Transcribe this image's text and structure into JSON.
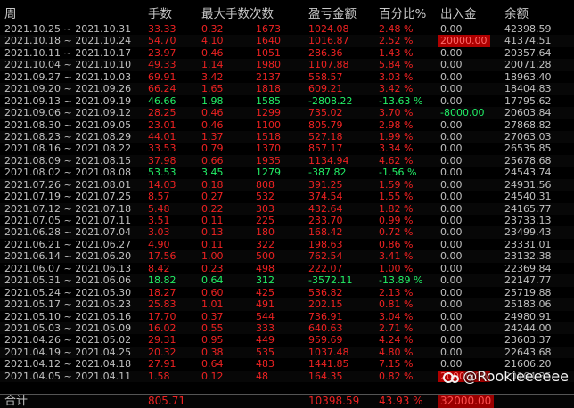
{
  "headers": {
    "week": "周",
    "hands": "手数",
    "max_hands_count": "最大手数次数",
    "profit_loss": "盈亏金额",
    "percent": "百分比%",
    "cash_flow": "出入金",
    "balance": "余额"
  },
  "rows": [
    {
      "week": "2021.10.25 ~ 2021.10.31",
      "hands": "33.33",
      "max": "0.32",
      "count": "1673",
      "pl": "1024.08",
      "pct": "2.48 %",
      "flow": "0.00",
      "bal": "42398.59",
      "color": "red"
    },
    {
      "week": "2021.10.18 ~ 2021.10.24",
      "hands": "54.70",
      "max": "4.10",
      "count": "1640",
      "pl": "1016.87",
      "pct": "2.52 %",
      "flow": "20000.00",
      "bal": "41374.51",
      "color": "red",
      "flow_hl": true
    },
    {
      "week": "2021.10.11 ~ 2021.10.17",
      "hands": "23.97",
      "max": "0.46",
      "count": "1051",
      "pl": "286.36",
      "pct": "1.43 %",
      "flow": "0.00",
      "bal": "20357.64",
      "color": "red"
    },
    {
      "week": "2021.10.04 ~ 2021.10.10",
      "hands": "49.33",
      "max": "1.14",
      "count": "1980",
      "pl": "1107.88",
      "pct": "5.84 %",
      "flow": "0.00",
      "bal": "20071.28",
      "color": "red"
    },
    {
      "week": "2021.09.27 ~ 2021.10.03",
      "hands": "69.91",
      "max": "3.42",
      "count": "2137",
      "pl": "558.57",
      "pct": "3.03 %",
      "flow": "0.00",
      "bal": "18963.40",
      "color": "red"
    },
    {
      "week": "2021.09.20 ~ 2021.09.26",
      "hands": "66.24",
      "max": "1.65",
      "count": "1818",
      "pl": "609.21",
      "pct": "3.42 %",
      "flow": "0.00",
      "bal": "18404.83",
      "color": "red"
    },
    {
      "week": "2021.09.13 ~ 2021.09.19",
      "hands": "46.66",
      "max": "1.98",
      "count": "1585",
      "pl": "-2808.22",
      "pct": "-13.63 %",
      "flow": "0.00",
      "bal": "17795.62",
      "color": "green"
    },
    {
      "week": "2021.09.06 ~ 2021.09.12",
      "hands": "28.25",
      "max": "0.46",
      "count": "1299",
      "pl": "735.02",
      "pct": "3.70 %",
      "flow": "-8000.00",
      "bal": "20603.84",
      "color": "red",
      "flow_green": true
    },
    {
      "week": "2021.08.30 ~ 2021.09.05",
      "hands": "23.01",
      "max": "0.46",
      "count": "1100",
      "pl": "805.79",
      "pct": "2.98 %",
      "flow": "0.00",
      "bal": "27868.82",
      "color": "red"
    },
    {
      "week": "2021.08.23 ~ 2021.08.29",
      "hands": "44.01",
      "max": "1.37",
      "count": "1518",
      "pl": "527.18",
      "pct": "1.99 %",
      "flow": "0.00",
      "bal": "27063.03",
      "color": "red"
    },
    {
      "week": "2021.08.16 ~ 2021.08.22",
      "hands": "33.53",
      "max": "0.79",
      "count": "1370",
      "pl": "857.17",
      "pct": "3.34 %",
      "flow": "0.00",
      "bal": "26535.85",
      "color": "red"
    },
    {
      "week": "2021.08.09 ~ 2021.08.15",
      "hands": "37.98",
      "max": "0.66",
      "count": "1935",
      "pl": "1134.94",
      "pct": "4.62 %",
      "flow": "0.00",
      "bal": "25678.68",
      "color": "red"
    },
    {
      "week": "2021.08.02 ~ 2021.08.08",
      "hands": "53.53",
      "max": "3.45",
      "count": "1279",
      "pl": "-387.82",
      "pct": "-1.56 %",
      "flow": "0.00",
      "bal": "24543.74",
      "color": "green"
    },
    {
      "week": "2021.07.26 ~ 2021.08.01",
      "hands": "14.03",
      "max": "0.18",
      "count": "808",
      "pl": "391.25",
      "pct": "1.59 %",
      "flow": "0.00",
      "bal": "24931.56",
      "color": "red"
    },
    {
      "week": "2021.07.19 ~ 2021.07.25",
      "hands": "8.57",
      "max": "0.27",
      "count": "532",
      "pl": "374.54",
      "pct": "1.55 %",
      "flow": "0.00",
      "bal": "24540.31",
      "color": "red"
    },
    {
      "week": "2021.07.12 ~ 2021.07.18",
      "hands": "5.48",
      "max": "0.22",
      "count": "303",
      "pl": "432.64",
      "pct": "1.82 %",
      "flow": "0.00",
      "bal": "24165.77",
      "color": "red"
    },
    {
      "week": "2021.07.05 ~ 2021.07.11",
      "hands": "3.51",
      "max": "0.11",
      "count": "225",
      "pl": "233.70",
      "pct": "0.99 %",
      "flow": "0.00",
      "bal": "23733.13",
      "color": "red"
    },
    {
      "week": "2021.06.28 ~ 2021.07.04",
      "hands": "3.03",
      "max": "0.13",
      "count": "180",
      "pl": "168.42",
      "pct": "0.72 %",
      "flow": "0.00",
      "bal": "23499.43",
      "color": "red"
    },
    {
      "week": "2021.06.21 ~ 2021.06.27",
      "hands": "4.90",
      "max": "0.11",
      "count": "322",
      "pl": "198.63",
      "pct": "0.86 %",
      "flow": "0.00",
      "bal": "23331.01",
      "color": "red"
    },
    {
      "week": "2021.06.14 ~ 2021.06.20",
      "hands": "17.56",
      "max": "1.00",
      "count": "500",
      "pl": "762.54",
      "pct": "3.41 %",
      "flow": "0.00",
      "bal": "23132.38",
      "color": "red"
    },
    {
      "week": "2021.06.07 ~ 2021.06.13",
      "hands": "8.42",
      "max": "0.23",
      "count": "498",
      "pl": "222.07",
      "pct": "1.00 %",
      "flow": "0.00",
      "bal": "22369.84",
      "color": "red"
    },
    {
      "week": "2021.05.31 ~ 2021.06.06",
      "hands": "18.82",
      "max": "0.64",
      "count": "312",
      "pl": "-3572.11",
      "pct": "-13.89 %",
      "flow": "0.00",
      "bal": "22147.77",
      "color": "green"
    },
    {
      "week": "2021.05.24 ~ 2021.05.30",
      "hands": "18.27",
      "max": "0.60",
      "count": "425",
      "pl": "536.82",
      "pct": "2.13 %",
      "flow": "0.00",
      "bal": "25719.88",
      "color": "red"
    },
    {
      "week": "2021.05.17 ~ 2021.05.23",
      "hands": "25.83",
      "max": "1.01",
      "count": "491",
      "pl": "202.15",
      "pct": "0.81 %",
      "flow": "0.00",
      "bal": "25183.06",
      "color": "red"
    },
    {
      "week": "2021.05.10 ~ 2021.05.16",
      "hands": "17.70",
      "max": "0.37",
      "count": "544",
      "pl": "736.91",
      "pct": "3.04 %",
      "flow": "0.00",
      "bal": "24980.91",
      "color": "red"
    },
    {
      "week": "2021.05.03 ~ 2021.05.09",
      "hands": "16.02",
      "max": "0.55",
      "count": "333",
      "pl": "640.63",
      "pct": "2.71 %",
      "flow": "0.00",
      "bal": "24244.00",
      "color": "red"
    },
    {
      "week": "2021.04.26 ~ 2021.05.02",
      "hands": "29.31",
      "max": "0.95",
      "count": "449",
      "pl": "959.69",
      "pct": "4.24 %",
      "flow": "0.00",
      "bal": "23603.37",
      "color": "red"
    },
    {
      "week": "2021.04.19 ~ 2021.04.25",
      "hands": "20.32",
      "max": "0.38",
      "count": "535",
      "pl": "1037.48",
      "pct": "4.80 %",
      "flow": "0.00",
      "bal": "22643.68",
      "color": "red"
    },
    {
      "week": "2021.04.12 ~ 2021.04.18",
      "hands": "27.91",
      "max": "0.64",
      "count": "483",
      "pl": "1441.85",
      "pct": "7.15 %",
      "flow": "0.00",
      "bal": "21606.20",
      "color": "red"
    },
    {
      "week": "2021.04.05 ~ 2021.04.11",
      "hands": "1.58",
      "max": "0.12",
      "count": "48",
      "pl": "164.35",
      "pct": "0.82 %",
      "flow": "20000.00",
      "bal": "20164.35",
      "color": "red",
      "flow_hl": true
    }
  ],
  "total": {
    "label": "合计",
    "hands": "805.71",
    "pl": "10398.59",
    "pct": "43.93 %",
    "flow": "32000.00"
  },
  "watermark": "@Rookieeeeee",
  "colors": {
    "background": "#000000",
    "positive": "#ee2222",
    "negative": "#22ee66",
    "neutral": "#c0c0c0",
    "flow_highlight": "#b00000"
  }
}
